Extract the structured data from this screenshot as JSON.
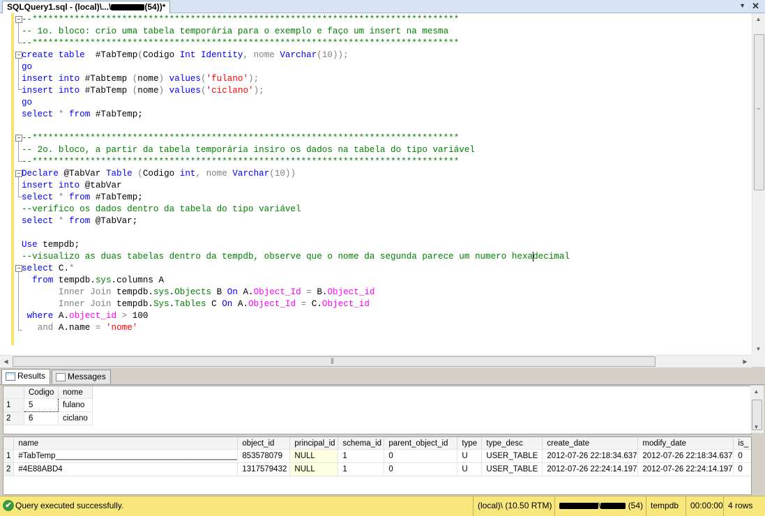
{
  "document_tab": {
    "prefix": "SQLQuery1.sql - (local)\\...\\",
    "suffix": "(54))*"
  },
  "editor": {
    "lines": [
      [
        {
          "t": "--*********************************************************************************",
          "c": "cm"
        }
      ],
      [
        {
          "t": "-- 1o. bloco: crio uma tabela temporária para o exemplo e faço um insert na mesma",
          "c": "cm"
        }
      ],
      [
        {
          "t": "--*********************************************************************************",
          "c": "cm"
        }
      ],
      [
        {
          "t": "create table",
          "c": "kw"
        },
        {
          "t": "  #TabTemp",
          "c": ""
        },
        {
          "t": "(",
          "c": "gr"
        },
        {
          "t": "Codigo ",
          "c": ""
        },
        {
          "t": "Int",
          "c": "kw"
        },
        {
          "t": " ",
          "c": ""
        },
        {
          "t": "Identity",
          "c": "kw"
        },
        {
          "t": ", nome ",
          "c": "gr"
        },
        {
          "t": "Varchar",
          "c": "kw"
        },
        {
          "t": "(10));",
          "c": "gr"
        }
      ],
      [
        {
          "t": "go",
          "c": "kw"
        }
      ],
      [
        {
          "t": "insert into",
          "c": "kw"
        },
        {
          "t": " #Tabtemp ",
          "c": ""
        },
        {
          "t": "(",
          "c": "gr"
        },
        {
          "t": "nome",
          "c": ""
        },
        {
          "t": ") ",
          "c": "gr"
        },
        {
          "t": "values",
          "c": "kw"
        },
        {
          "t": "(",
          "c": "gr"
        },
        {
          "t": "'fulano'",
          "c": "str"
        },
        {
          "t": ");",
          "c": "gr"
        }
      ],
      [
        {
          "t": "insert into",
          "c": "kw"
        },
        {
          "t": " #TabTemp ",
          "c": ""
        },
        {
          "t": "(",
          "c": "gr"
        },
        {
          "t": "nome",
          "c": ""
        },
        {
          "t": ") ",
          "c": "gr"
        },
        {
          "t": "values",
          "c": "kw"
        },
        {
          "t": "(",
          "c": "gr"
        },
        {
          "t": "'ciclano'",
          "c": "str"
        },
        {
          "t": ");",
          "c": "gr"
        }
      ],
      [
        {
          "t": "go",
          "c": "kw"
        }
      ],
      [
        {
          "t": "select",
          "c": "kw"
        },
        {
          "t": " * ",
          "c": "gr"
        },
        {
          "t": "from",
          "c": "kw"
        },
        {
          "t": " #TabTemp;",
          "c": ""
        }
      ],
      [
        {
          "t": "",
          "c": ""
        }
      ],
      [
        {
          "t": "--*********************************************************************************",
          "c": "cm"
        }
      ],
      [
        {
          "t": "-- 2o. bloco, a partir da tabela temporária insiro os dados na tabela do tipo variável",
          "c": "cm"
        }
      ],
      [
        {
          "t": "--*********************************************************************************",
          "c": "cm"
        }
      ],
      [
        {
          "t": "Declare",
          "c": "kw"
        },
        {
          "t": " @TabVar ",
          "c": ""
        },
        {
          "t": "Table",
          "c": "kw"
        },
        {
          "t": " (",
          "c": "gr"
        },
        {
          "t": "Codigo ",
          "c": ""
        },
        {
          "t": "int",
          "c": "kw"
        },
        {
          "t": ", nome ",
          "c": "gr"
        },
        {
          "t": "Varchar",
          "c": "kw"
        },
        {
          "t": "(10))",
          "c": "gr"
        }
      ],
      [
        {
          "t": "insert into",
          "c": "kw"
        },
        {
          "t": " @tabVar",
          "c": ""
        }
      ],
      [
        {
          "t": "select",
          "c": "kw"
        },
        {
          "t": " * ",
          "c": "gr"
        },
        {
          "t": "from",
          "c": "kw"
        },
        {
          "t": " #TabTemp;",
          "c": ""
        }
      ],
      [
        {
          "t": "--verifico os dados dentro da tabela do tipo variável",
          "c": "cm"
        }
      ],
      [
        {
          "t": "select",
          "c": "kw"
        },
        {
          "t": " * ",
          "c": "gr"
        },
        {
          "t": "from",
          "c": "kw"
        },
        {
          "t": " @TabVar;",
          "c": ""
        }
      ],
      [
        {
          "t": "",
          "c": ""
        }
      ],
      [
        {
          "t": "Use",
          "c": "kw"
        },
        {
          "t": " tempdb;",
          "c": ""
        }
      ],
      [
        {
          "t": "--visualizo as duas tabelas dentro da tempdb, observe que o nome da segunda parece um numero hexa",
          "c": "cm"
        },
        {
          "caret": true
        },
        {
          "t": "decimal",
          "c": "cm"
        }
      ],
      [
        {
          "t": "select",
          "c": "kw"
        },
        {
          "t": " C.",
          "c": ""
        },
        {
          "t": "*",
          "c": "gr"
        }
      ],
      [
        {
          "t": "  ",
          "c": ""
        },
        {
          "t": "from",
          "c": "kw"
        },
        {
          "t": " tempdb.",
          "c": ""
        },
        {
          "t": "sys",
          "c": "sys"
        },
        {
          "t": ".columns A",
          "c": ""
        }
      ],
      [
        {
          "t": "       ",
          "c": ""
        },
        {
          "t": "Inner Join",
          "c": "gr"
        },
        {
          "t": " tempdb.",
          "c": ""
        },
        {
          "t": "sys",
          "c": "sys"
        },
        {
          "t": ".",
          "c": ""
        },
        {
          "t": "Objects",
          "c": "sys"
        },
        {
          "t": " B ",
          "c": ""
        },
        {
          "t": "On",
          "c": "kw"
        },
        {
          "t": " A.",
          "c": ""
        },
        {
          "t": "Object_Id",
          "c": "fn"
        },
        {
          "t": " = ",
          "c": "gr"
        },
        {
          "t": "B.",
          "c": ""
        },
        {
          "t": "Object_id",
          "c": "fn"
        }
      ],
      [
        {
          "t": "       ",
          "c": ""
        },
        {
          "t": "Inner Join",
          "c": "gr"
        },
        {
          "t": " tempdb.",
          "c": ""
        },
        {
          "t": "Sys",
          "c": "sys"
        },
        {
          "t": ".",
          "c": ""
        },
        {
          "t": "Tables",
          "c": "sys"
        },
        {
          "t": " C ",
          "c": ""
        },
        {
          "t": "On",
          "c": "kw"
        },
        {
          "t": " A.",
          "c": ""
        },
        {
          "t": "Object_Id",
          "c": "fn"
        },
        {
          "t": " = ",
          "c": "gr"
        },
        {
          "t": "C.",
          "c": ""
        },
        {
          "t": "Object_id",
          "c": "fn"
        }
      ],
      [
        {
          "t": " ",
          "c": ""
        },
        {
          "t": "where",
          "c": "kw"
        },
        {
          "t": " A.",
          "c": ""
        },
        {
          "t": "object_id",
          "c": "fn"
        },
        {
          "t": " > ",
          "c": "gr"
        },
        {
          "t": "100",
          "c": ""
        }
      ],
      [
        {
          "t": "   ",
          "c": ""
        },
        {
          "t": "and",
          "c": "gr"
        },
        {
          "t": " A.name ",
          "c": ""
        },
        {
          "t": "=",
          "c": "gr"
        },
        {
          "t": " ",
          "c": ""
        },
        {
          "t": "'nome'",
          "c": "str"
        }
      ]
    ]
  },
  "result_tabs": [
    {
      "label": "Results",
      "active": true
    },
    {
      "label": "Messages",
      "active": false
    }
  ],
  "grid1": {
    "columns": [
      "Codigo",
      "nome"
    ],
    "rows": [
      {
        "n": "1",
        "cells": [
          "5",
          "fulano"
        ]
      },
      {
        "n": "2",
        "cells": [
          "6",
          "ciclano"
        ]
      }
    ]
  },
  "grid2": {
    "columns": [
      "name",
      "object_id",
      "principal_id",
      "schema_id",
      "parent_object_id",
      "type",
      "type_desc",
      "create_date",
      "modify_date",
      "is_"
    ],
    "rows": [
      {
        "n": "1",
        "cells": [
          "#TabTemp________________________________________________________________________________________________________",
          "853578079",
          "NULL",
          "1",
          "0",
          "U",
          "USER_TABLE",
          "2012-07-26 22:18:34.637",
          "2012-07-26 22:18:34.637",
          "0"
        ]
      },
      {
        "n": "2",
        "cells": [
          "#4E88ABD4",
          "1317579432",
          "NULL",
          "1",
          "0",
          "U",
          "USER_TABLE",
          "2012-07-26 22:24:14.197",
          "2012-07-26 22:24:14.197",
          "0"
        ]
      }
    ]
  },
  "status": {
    "message": "Query executed successfully.",
    "server": "(local)\\ (10.50 RTM)",
    "spid": "(54)",
    "database": "tempdb",
    "elapsed": "00:00:00",
    "rows": "4 rows"
  },
  "icons": {
    "status_ok": "✔",
    "tab_dropdown": "▼",
    "tab_close": "✕",
    "scroll_up": "▲",
    "scroll_down": "▼",
    "scroll_left": "◀",
    "scroll_right": "▶"
  }
}
